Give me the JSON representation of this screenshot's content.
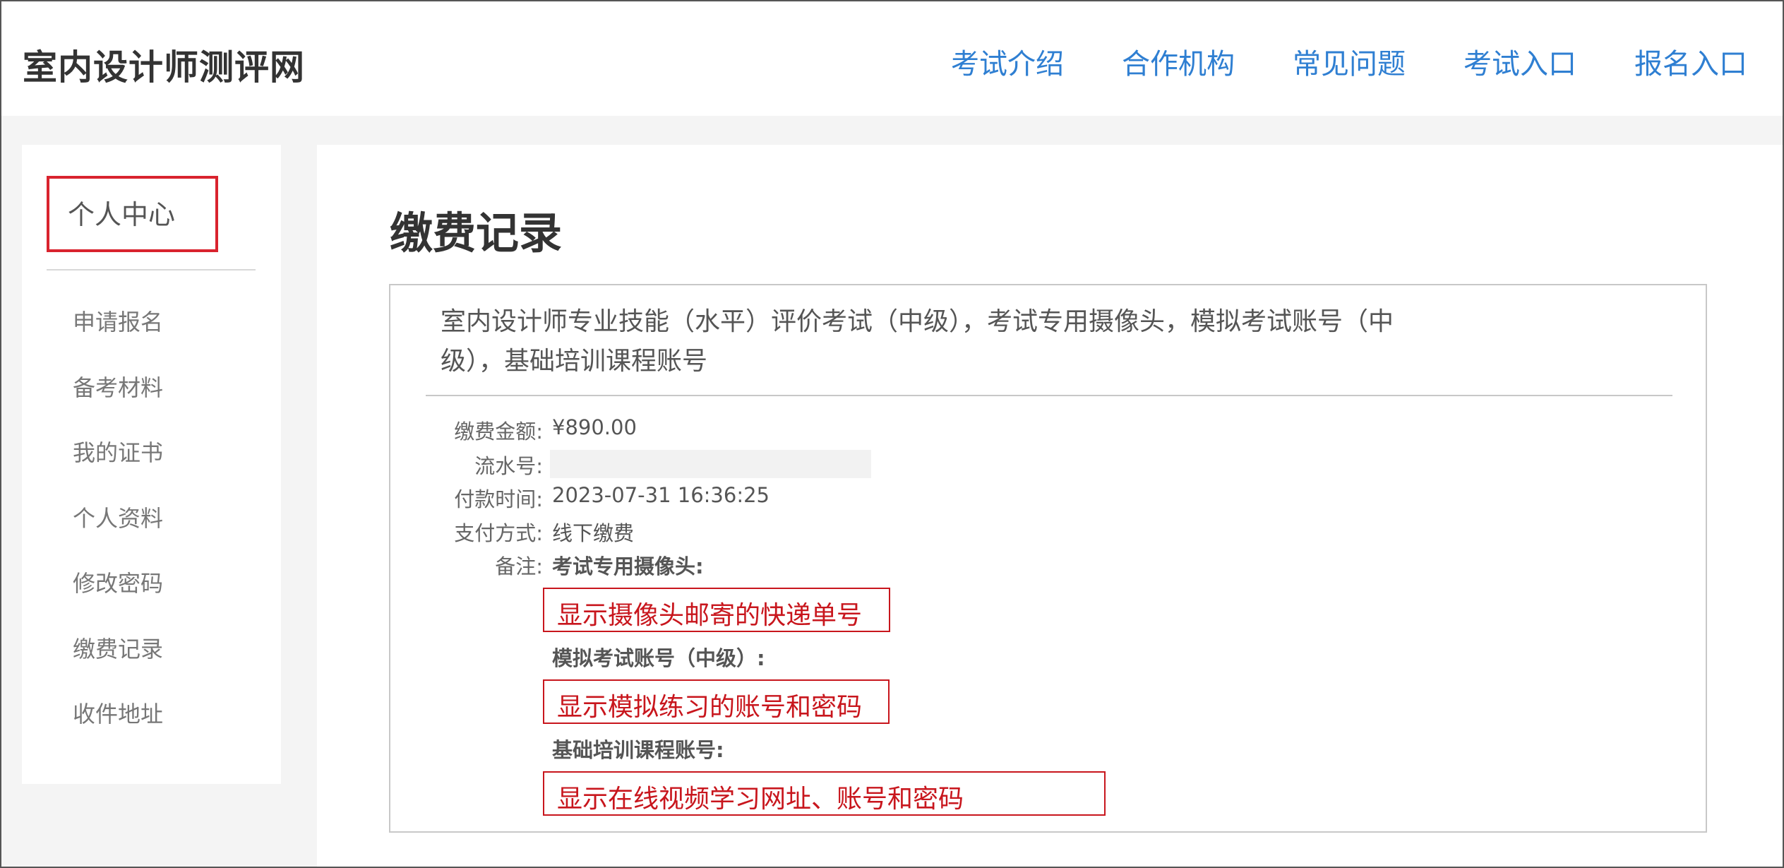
{
  "header": {
    "site_title": "室内设计师测评网",
    "nav": [
      "考试介绍",
      "合作机构",
      "常见问题",
      "考试入口",
      "报名入口"
    ]
  },
  "sidebar": {
    "title": "个人中心",
    "items": [
      "申请报名",
      "备考材料",
      "我的证书",
      "个人资料",
      "修改密码",
      "缴费记录",
      "收件地址"
    ]
  },
  "main": {
    "page_title": "缴费记录",
    "record": {
      "title": "室内设计师专业技能（水平）评价考试（中级），考试专用摄像头，模拟考试账号（中级），基础培训课程账号",
      "amount_label": "缴费金额:",
      "amount": "¥890.00",
      "serial_label": "流水号:",
      "serial": "",
      "pay_time_label": "付款时间:",
      "pay_time": "2023-07-31 16:36:25",
      "pay_method_label": "支付方式:",
      "pay_method": "线下缴费",
      "notes_label": "备注:",
      "notes": [
        {
          "heading": "考试专用摄像头:",
          "placeholder": "显示摄像头邮寄的快递单号"
        },
        {
          "heading": "模拟考试账号（中级）:",
          "placeholder": "显示模拟练习的账号和密码"
        },
        {
          "heading": "基础培训课程账号:",
          "placeholder": "显示在线视频学习网址、账号和密码"
        }
      ]
    }
  },
  "colors": {
    "nav_link": "#2f7fd2",
    "highlight_red": "#c8161d",
    "page_bg": "#f4f4f4"
  }
}
